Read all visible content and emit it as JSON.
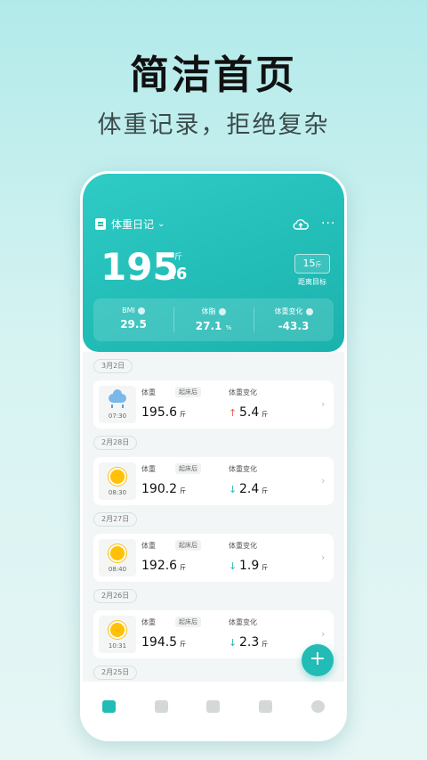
{
  "promo": {
    "title": "简洁首页",
    "subtitle": "体重记录，拒绝复杂"
  },
  "header": {
    "diary_label": "体重日记",
    "weight_int": "195",
    "weight_dec": ".6",
    "unit": "斤",
    "goal_value": "15",
    "goal_unit": "斤",
    "goal_label": "距离目标",
    "stats": [
      {
        "label": "BMI",
        "value": "29.5",
        "unit": ""
      },
      {
        "label": "体脂",
        "value": "27.1",
        "unit": "%"
      },
      {
        "label": "体重变化",
        "value": "-43.3",
        "unit": ""
      }
    ]
  },
  "entries": [
    {
      "date": "3月2日",
      "time": "07:30",
      "weather": "rain",
      "weight_label": "体重",
      "tag": "起床后",
      "weight": "195.6",
      "unit": "斤",
      "change_label": "体重变化",
      "change": "5.4",
      "direction": "up"
    },
    {
      "date": "2月28日",
      "time": "08:30",
      "weather": "sun",
      "weight_label": "体重",
      "tag": "起床后",
      "weight": "190.2",
      "unit": "斤",
      "change_label": "体重变化",
      "change": "2.4",
      "direction": "down"
    },
    {
      "date": "2月27日",
      "time": "08:40",
      "weather": "sun",
      "weight_label": "体重",
      "tag": "起床后",
      "weight": "192.6",
      "unit": "斤",
      "change_label": "体重变化",
      "change": "1.9",
      "direction": "down"
    },
    {
      "date": "2月26日",
      "time": "10:31",
      "weather": "sun",
      "weight_label": "体重",
      "tag": "起床后",
      "weight": "194.5",
      "unit": "斤",
      "change_label": "体重变化",
      "change": "2.3",
      "direction": "down"
    }
  ],
  "next_date": "2月25日",
  "fab_label": "+",
  "colors": {
    "accent": "#22bbb5",
    "up": "#e8604c",
    "down": "#2bbab4"
  }
}
